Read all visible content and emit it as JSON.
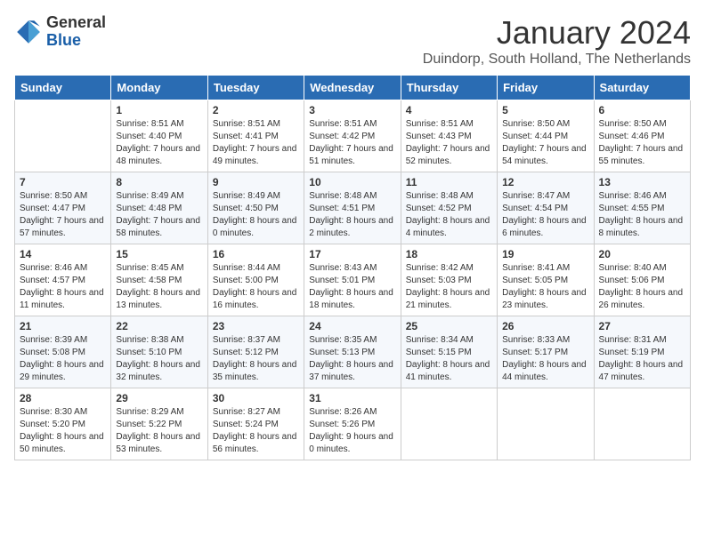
{
  "logo": {
    "general": "General",
    "blue": "Blue"
  },
  "header": {
    "month": "January 2024",
    "location": "Duindorp, South Holland, The Netherlands"
  },
  "weekdays": [
    "Sunday",
    "Monday",
    "Tuesday",
    "Wednesday",
    "Thursday",
    "Friday",
    "Saturday"
  ],
  "weeks": [
    [
      {
        "day": "",
        "sunrise": "",
        "sunset": "",
        "daylight": ""
      },
      {
        "day": "1",
        "sunrise": "Sunrise: 8:51 AM",
        "sunset": "Sunset: 4:40 PM",
        "daylight": "Daylight: 7 hours and 48 minutes."
      },
      {
        "day": "2",
        "sunrise": "Sunrise: 8:51 AM",
        "sunset": "Sunset: 4:41 PM",
        "daylight": "Daylight: 7 hours and 49 minutes."
      },
      {
        "day": "3",
        "sunrise": "Sunrise: 8:51 AM",
        "sunset": "Sunset: 4:42 PM",
        "daylight": "Daylight: 7 hours and 51 minutes."
      },
      {
        "day": "4",
        "sunrise": "Sunrise: 8:51 AM",
        "sunset": "Sunset: 4:43 PM",
        "daylight": "Daylight: 7 hours and 52 minutes."
      },
      {
        "day": "5",
        "sunrise": "Sunrise: 8:50 AM",
        "sunset": "Sunset: 4:44 PM",
        "daylight": "Daylight: 7 hours and 54 minutes."
      },
      {
        "day": "6",
        "sunrise": "Sunrise: 8:50 AM",
        "sunset": "Sunset: 4:46 PM",
        "daylight": "Daylight: 7 hours and 55 minutes."
      }
    ],
    [
      {
        "day": "7",
        "sunrise": "Sunrise: 8:50 AM",
        "sunset": "Sunset: 4:47 PM",
        "daylight": "Daylight: 7 hours and 57 minutes."
      },
      {
        "day": "8",
        "sunrise": "Sunrise: 8:49 AM",
        "sunset": "Sunset: 4:48 PM",
        "daylight": "Daylight: 7 hours and 58 minutes."
      },
      {
        "day": "9",
        "sunrise": "Sunrise: 8:49 AM",
        "sunset": "Sunset: 4:50 PM",
        "daylight": "Daylight: 8 hours and 0 minutes."
      },
      {
        "day": "10",
        "sunrise": "Sunrise: 8:48 AM",
        "sunset": "Sunset: 4:51 PM",
        "daylight": "Daylight: 8 hours and 2 minutes."
      },
      {
        "day": "11",
        "sunrise": "Sunrise: 8:48 AM",
        "sunset": "Sunset: 4:52 PM",
        "daylight": "Daylight: 8 hours and 4 minutes."
      },
      {
        "day": "12",
        "sunrise": "Sunrise: 8:47 AM",
        "sunset": "Sunset: 4:54 PM",
        "daylight": "Daylight: 8 hours and 6 minutes."
      },
      {
        "day": "13",
        "sunrise": "Sunrise: 8:46 AM",
        "sunset": "Sunset: 4:55 PM",
        "daylight": "Daylight: 8 hours and 8 minutes."
      }
    ],
    [
      {
        "day": "14",
        "sunrise": "Sunrise: 8:46 AM",
        "sunset": "Sunset: 4:57 PM",
        "daylight": "Daylight: 8 hours and 11 minutes."
      },
      {
        "day": "15",
        "sunrise": "Sunrise: 8:45 AM",
        "sunset": "Sunset: 4:58 PM",
        "daylight": "Daylight: 8 hours and 13 minutes."
      },
      {
        "day": "16",
        "sunrise": "Sunrise: 8:44 AM",
        "sunset": "Sunset: 5:00 PM",
        "daylight": "Daylight: 8 hours and 16 minutes."
      },
      {
        "day": "17",
        "sunrise": "Sunrise: 8:43 AM",
        "sunset": "Sunset: 5:01 PM",
        "daylight": "Daylight: 8 hours and 18 minutes."
      },
      {
        "day": "18",
        "sunrise": "Sunrise: 8:42 AM",
        "sunset": "Sunset: 5:03 PM",
        "daylight": "Daylight: 8 hours and 21 minutes."
      },
      {
        "day": "19",
        "sunrise": "Sunrise: 8:41 AM",
        "sunset": "Sunset: 5:05 PM",
        "daylight": "Daylight: 8 hours and 23 minutes."
      },
      {
        "day": "20",
        "sunrise": "Sunrise: 8:40 AM",
        "sunset": "Sunset: 5:06 PM",
        "daylight": "Daylight: 8 hours and 26 minutes."
      }
    ],
    [
      {
        "day": "21",
        "sunrise": "Sunrise: 8:39 AM",
        "sunset": "Sunset: 5:08 PM",
        "daylight": "Daylight: 8 hours and 29 minutes."
      },
      {
        "day": "22",
        "sunrise": "Sunrise: 8:38 AM",
        "sunset": "Sunset: 5:10 PM",
        "daylight": "Daylight: 8 hours and 32 minutes."
      },
      {
        "day": "23",
        "sunrise": "Sunrise: 8:37 AM",
        "sunset": "Sunset: 5:12 PM",
        "daylight": "Daylight: 8 hours and 35 minutes."
      },
      {
        "day": "24",
        "sunrise": "Sunrise: 8:35 AM",
        "sunset": "Sunset: 5:13 PM",
        "daylight": "Daylight: 8 hours and 37 minutes."
      },
      {
        "day": "25",
        "sunrise": "Sunrise: 8:34 AM",
        "sunset": "Sunset: 5:15 PM",
        "daylight": "Daylight: 8 hours and 41 minutes."
      },
      {
        "day": "26",
        "sunrise": "Sunrise: 8:33 AM",
        "sunset": "Sunset: 5:17 PM",
        "daylight": "Daylight: 8 hours and 44 minutes."
      },
      {
        "day": "27",
        "sunrise": "Sunrise: 8:31 AM",
        "sunset": "Sunset: 5:19 PM",
        "daylight": "Daylight: 8 hours and 47 minutes."
      }
    ],
    [
      {
        "day": "28",
        "sunrise": "Sunrise: 8:30 AM",
        "sunset": "Sunset: 5:20 PM",
        "daylight": "Daylight: 8 hours and 50 minutes."
      },
      {
        "day": "29",
        "sunrise": "Sunrise: 8:29 AM",
        "sunset": "Sunset: 5:22 PM",
        "daylight": "Daylight: 8 hours and 53 minutes."
      },
      {
        "day": "30",
        "sunrise": "Sunrise: 8:27 AM",
        "sunset": "Sunset: 5:24 PM",
        "daylight": "Daylight: 8 hours and 56 minutes."
      },
      {
        "day": "31",
        "sunrise": "Sunrise: 8:26 AM",
        "sunset": "Sunset: 5:26 PM",
        "daylight": "Daylight: 9 hours and 0 minutes."
      },
      {
        "day": "",
        "sunrise": "",
        "sunset": "",
        "daylight": ""
      },
      {
        "day": "",
        "sunrise": "",
        "sunset": "",
        "daylight": ""
      },
      {
        "day": "",
        "sunrise": "",
        "sunset": "",
        "daylight": ""
      }
    ]
  ]
}
